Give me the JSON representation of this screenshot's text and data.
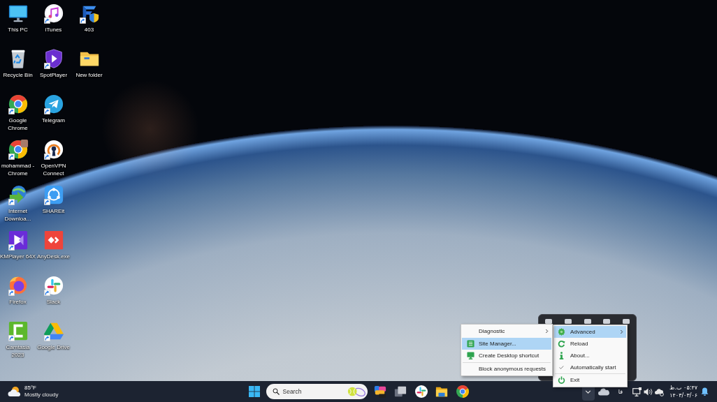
{
  "desktop_icons": [
    {
      "label": "This PC",
      "shortcut": false
    },
    {
      "label": "Recycle Bin",
      "shortcut": false
    },
    {
      "label": "Google Chrome",
      "shortcut": true
    },
    {
      "label": "mohammad - Chrome",
      "shortcut": true
    },
    {
      "label": "Internet Downloa...",
      "shortcut": true
    },
    {
      "label": "KMPlayer 64X",
      "shortcut": true
    },
    {
      "label": "Firefox",
      "shortcut": true
    },
    {
      "label": "Camtasia 2023",
      "shortcut": true
    },
    {
      "label": "iTunes",
      "shortcut": true
    },
    {
      "label": "SpotPlayer",
      "shortcut": true
    },
    {
      "label": "Telegram",
      "shortcut": true
    },
    {
      "label": "OpenVPN Connect",
      "shortcut": true
    },
    {
      "label": "SHAREit",
      "shortcut": true
    },
    {
      "label": "AnyDesk.exe",
      "shortcut": false
    },
    {
      "label": "Slack",
      "shortcut": true
    },
    {
      "label": "Google Drive",
      "shortcut": true
    },
    {
      "label": "403",
      "shortcut": true
    },
    {
      "label": "New folder",
      "shortcut": false
    }
  ],
  "advanced_submenu": {
    "items": [
      {
        "label": "Diagnostic",
        "kind": "submenu",
        "selected": false
      },
      {
        "label": "Site Manager...",
        "kind": "command",
        "selected": true
      },
      {
        "label": "Create Desktop shortcut",
        "kind": "command",
        "selected": false
      },
      {
        "kind": "separator"
      },
      {
        "label": "Block anonymous requests",
        "kind": "command",
        "selected": false
      }
    ]
  },
  "tray_menu": {
    "items": [
      {
        "label": "Advanced",
        "kind": "submenu",
        "selected": true
      },
      {
        "label": "Reload",
        "kind": "command",
        "selected": false
      },
      {
        "label": "About...",
        "kind": "command",
        "selected": false
      },
      {
        "label": "Automatically start",
        "kind": "toggle",
        "checked": true,
        "selected": false
      },
      {
        "kind": "separator"
      },
      {
        "label": "Exit",
        "kind": "command",
        "selected": false
      }
    ]
  },
  "taskbar": {
    "weather": {
      "temperature": "85°F",
      "condition": "Mostly cloudy"
    },
    "search": {
      "placeholder": "Search"
    },
    "tray": {
      "overflow_expanded": true,
      "language": "فا"
    },
    "clock": {
      "time": "۰۵:۴۷ ب.ظ",
      "date": "۱۴۰۳/۰۳/۰۶"
    }
  }
}
